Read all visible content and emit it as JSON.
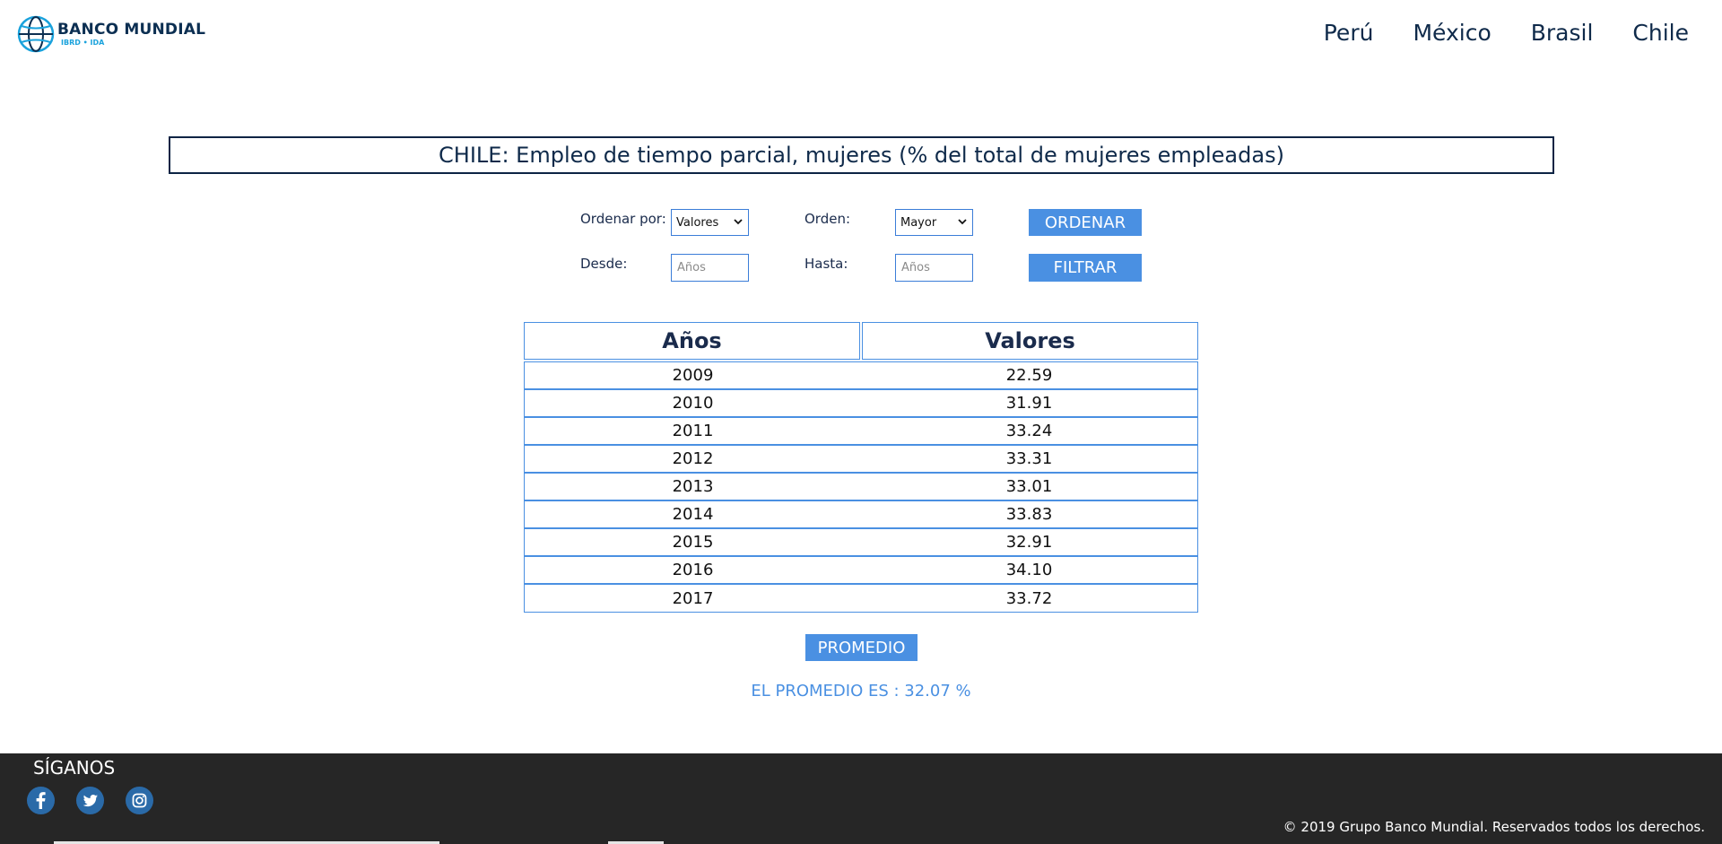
{
  "header": {
    "logo": {
      "main": "BANCO  MUNDIAL",
      "sub": "IBRD • IDA"
    },
    "nav": [
      "Perú",
      "México",
      "Brasil",
      "Chile"
    ]
  },
  "title": "CHILE: Empleo de tiempo parcial, mujeres (% del total de mujeres empleadas)",
  "controls": {
    "sort_by_label": "Ordenar por:",
    "sort_by_value": "Valores",
    "order_label": "Orden:",
    "order_value": "Mayor",
    "sort_button": "ORDENAR",
    "from_label": "Desde:",
    "from_placeholder": "Años",
    "to_label": "Hasta:",
    "to_placeholder": "Años",
    "filter_button": "FILTRAR"
  },
  "table": {
    "headers": [
      "Años",
      "Valores"
    ],
    "rows": [
      [
        "2009",
        "22.59"
      ],
      [
        "2010",
        "31.91"
      ],
      [
        "2011",
        "33.24"
      ],
      [
        "2012",
        "33.31"
      ],
      [
        "2013",
        "33.01"
      ],
      [
        "2014",
        "33.83"
      ],
      [
        "2015",
        "32.91"
      ],
      [
        "2016",
        "34.10"
      ],
      [
        "2017",
        "33.72"
      ]
    ]
  },
  "average": {
    "button": "PROMEDIO",
    "result": "EL PROMEDIO ES : 32.07 %"
  },
  "footer": {
    "follow": "SÍGANOS",
    "social": [
      "facebook-icon",
      "twitter-icon",
      "instagram-icon"
    ],
    "copyright": "© 2019 Grupo Banco Mundial. Reservados todos los derechos."
  },
  "colors": {
    "accent": "#4a90e2",
    "navy": "#0f2a4a",
    "footer_bg": "#262626",
    "social_icon": "#2a6aa8"
  }
}
